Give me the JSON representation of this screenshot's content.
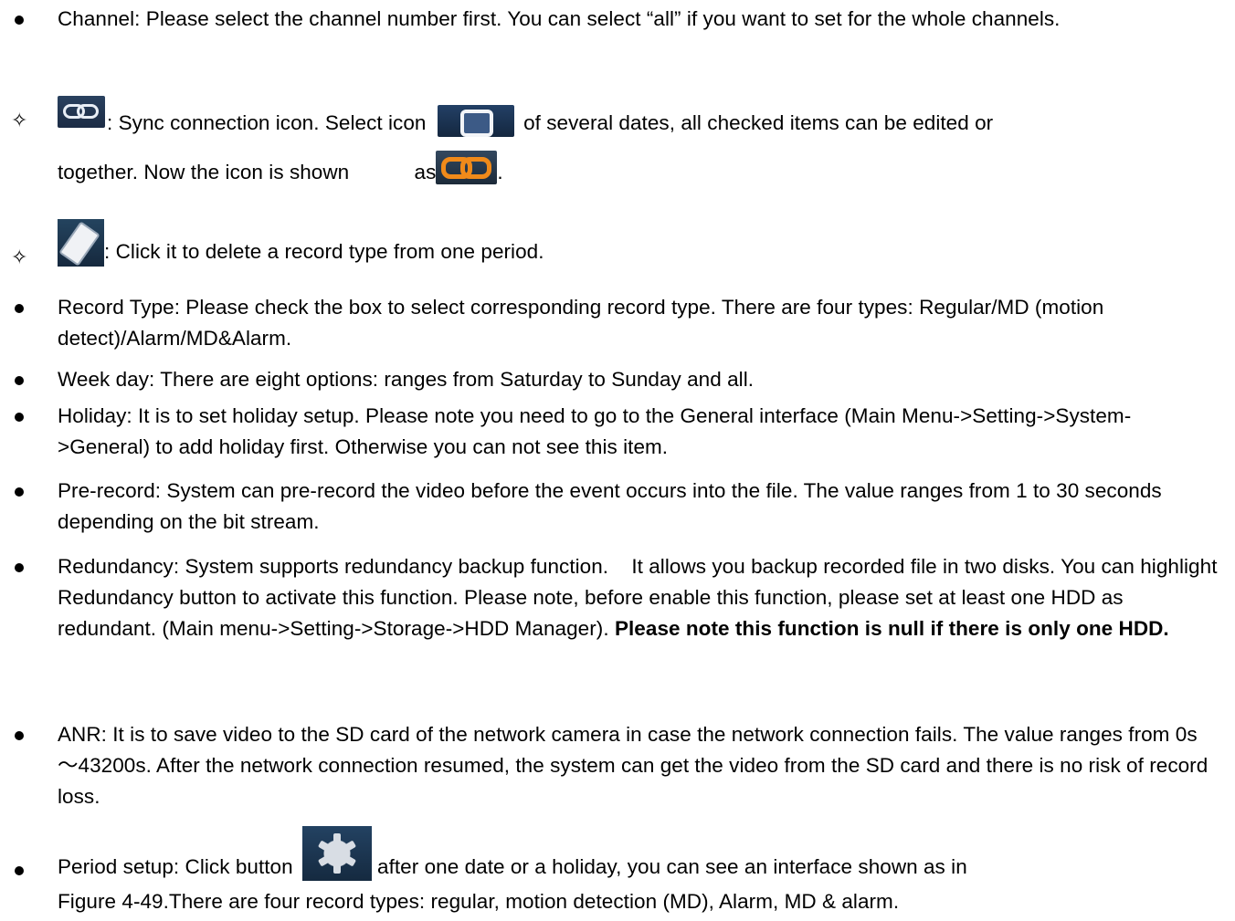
{
  "items": [
    {
      "marker": "bullet",
      "text": "Channel: Please select the channel number first. You can select “all” if you want to set for the whole channels."
    },
    {
      "marker": "diamond",
      "pre": ": Sync connection icon. Select icon",
      "mid": "of several dates, all checked items can be edited or",
      "line2a": "together. Now the icon is shown",
      "line2b": "as",
      "line2c": "."
    },
    {
      "marker": "diamond",
      "text": ": Click it to delete a record type from one period."
    },
    {
      "marker": "bullet",
      "text": "Record Type: Please check the box to select corresponding record type. There are four types: Regular/MD (motion detect)/Alarm/MD&Alarm."
    },
    {
      "marker": "bullet",
      "text": "Week day: There are eight options: ranges from Saturday to Sunday and all."
    },
    {
      "marker": "bullet",
      "text": "Holiday: It is to set holiday setup. Please note you need to go to the General interface (Main Menu->Setting->System->General) to add holiday first. Otherwise you can not see this item."
    },
    {
      "marker": "bullet",
      "text": "Pre-record: System can pre-record the video before the event occurs into the file. The value ranges from 1 to 30 seconds depending on the bit stream."
    },
    {
      "marker": "bullet",
      "text": "Redundancy: System supports redundancy backup function.    It allows you backup recorded file in two disks. You can highlight Redundancy button to activate this function. Please note, before enable this function, please set at least one HDD as redundant. (Main menu->Setting->Storage->HDD Manager).",
      "bold": "Please note this function is null if there is only one HDD."
    },
    {
      "marker": "bullet",
      "text": "ANR: It is to save video to the SD card of the network camera in case the network connection fails. The value ranges from 0s～43200s. After the network connection resumed, the system can get the video from the SD card and there is no risk of record loss."
    },
    {
      "marker": "bullet",
      "pre": "Period setup: Click button",
      "post": "after one date or a holiday, you can see an interface shown as in",
      "line2": "Figure 4-49.There are four record types: regular, motion detection (MD), Alarm, MD & alarm."
    }
  ],
  "markers": {
    "bullet": "●",
    "diamond": "✧"
  },
  "icons": [
    "sync-chain-icon",
    "select-square-icon",
    "linked-chain-icon",
    "eraser-icon",
    "gear-icon"
  ]
}
